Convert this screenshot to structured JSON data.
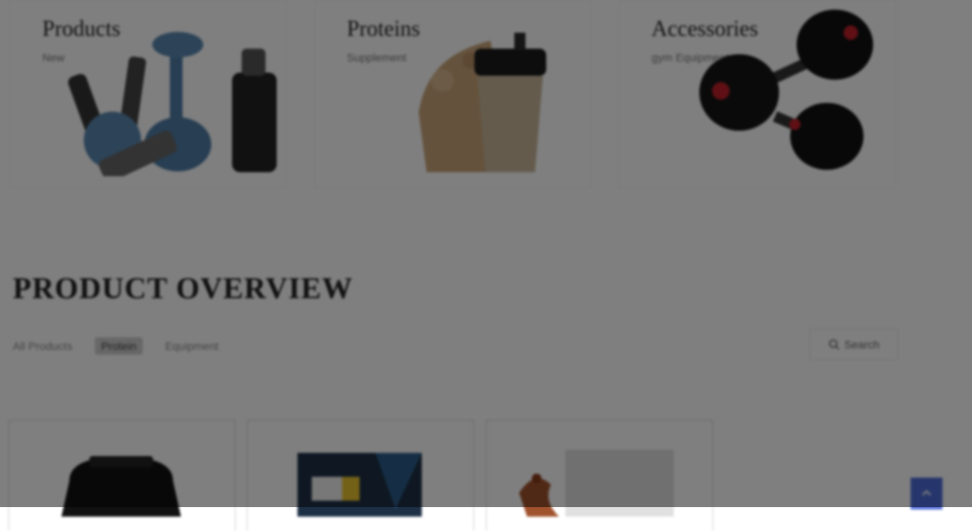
{
  "categories": [
    {
      "title": "Products",
      "subtitle": "New"
    },
    {
      "title": "Proteins",
      "subtitle": "Supplement"
    },
    {
      "title": "Accessories",
      "subtitle": "gym Equipment"
    }
  ],
  "overview": {
    "title": "PRODUCT OVERVIEW",
    "filters": [
      "All Products",
      "Protein",
      "Equipment"
    ],
    "active_filter": 1,
    "search_label": "Search",
    "search_icon": "search-icon"
  },
  "scroll_top_icon": "arrow-up-icon",
  "colors": {
    "accent": "#4d6bd8",
    "overlay": "rgba(0,0,0,0.50)"
  }
}
